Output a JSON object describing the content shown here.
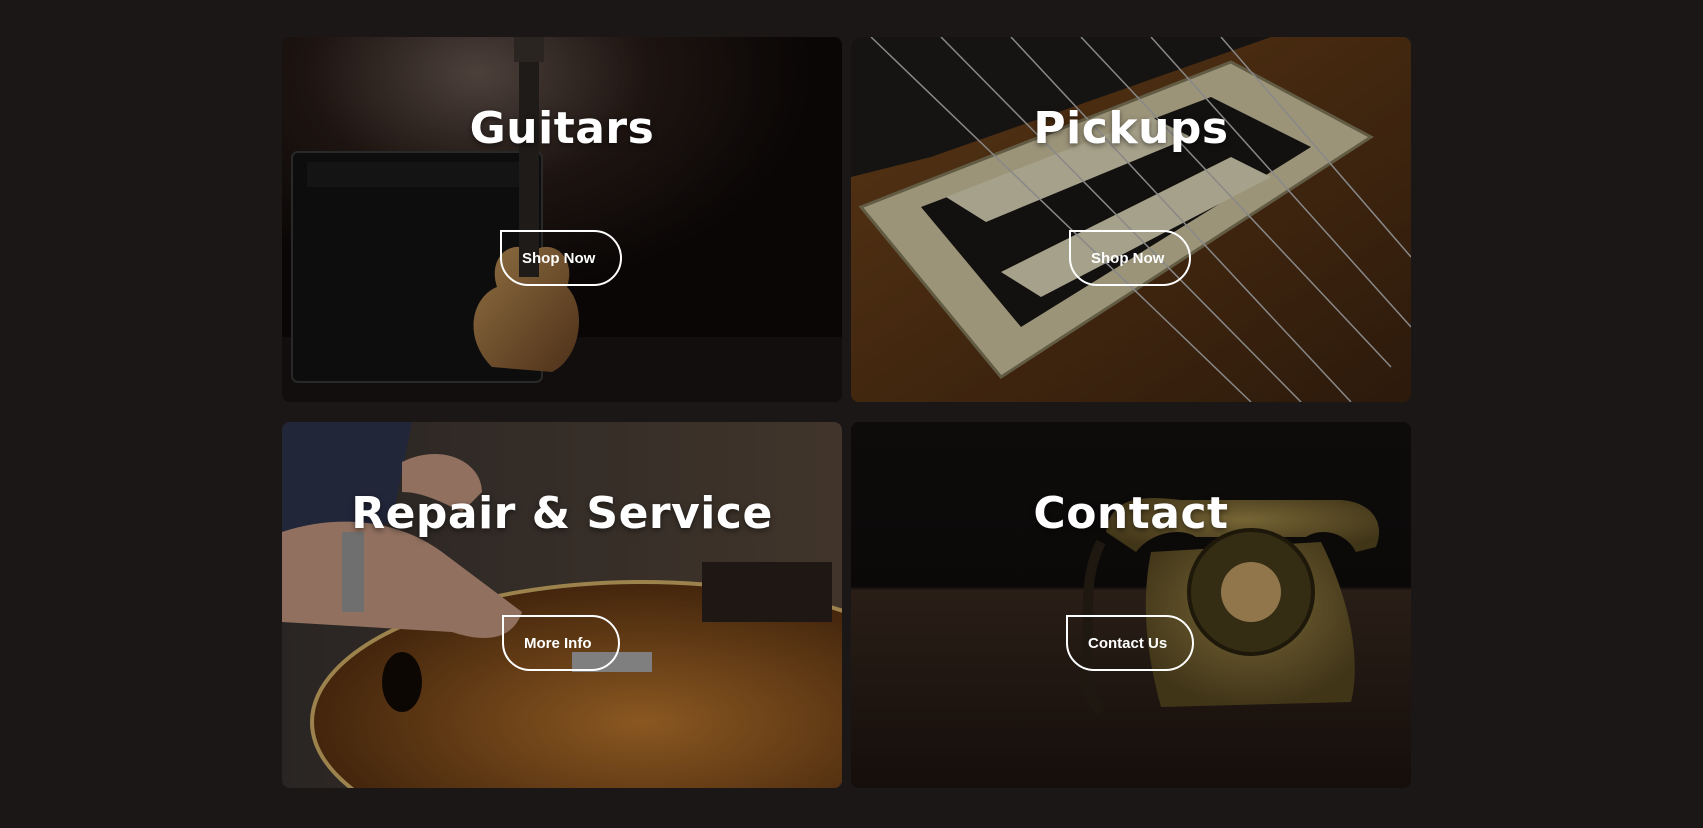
{
  "cards": [
    {
      "title": "Guitars",
      "button": "Shop Now",
      "image": "guitar-amp-stage-image"
    },
    {
      "title": "Pickups",
      "button": "Shop Now",
      "image": "humbucker-pickups-image"
    },
    {
      "title": "Repair & Service",
      "button": "More Info",
      "image": "guitar-repair-image"
    },
    {
      "title": "Contact",
      "button": "Contact Us",
      "image": "rotary-telephone-image"
    }
  ],
  "colors": {
    "page_background": "#1b1716",
    "text": "#ffffff",
    "button_border": "#ffffff"
  }
}
